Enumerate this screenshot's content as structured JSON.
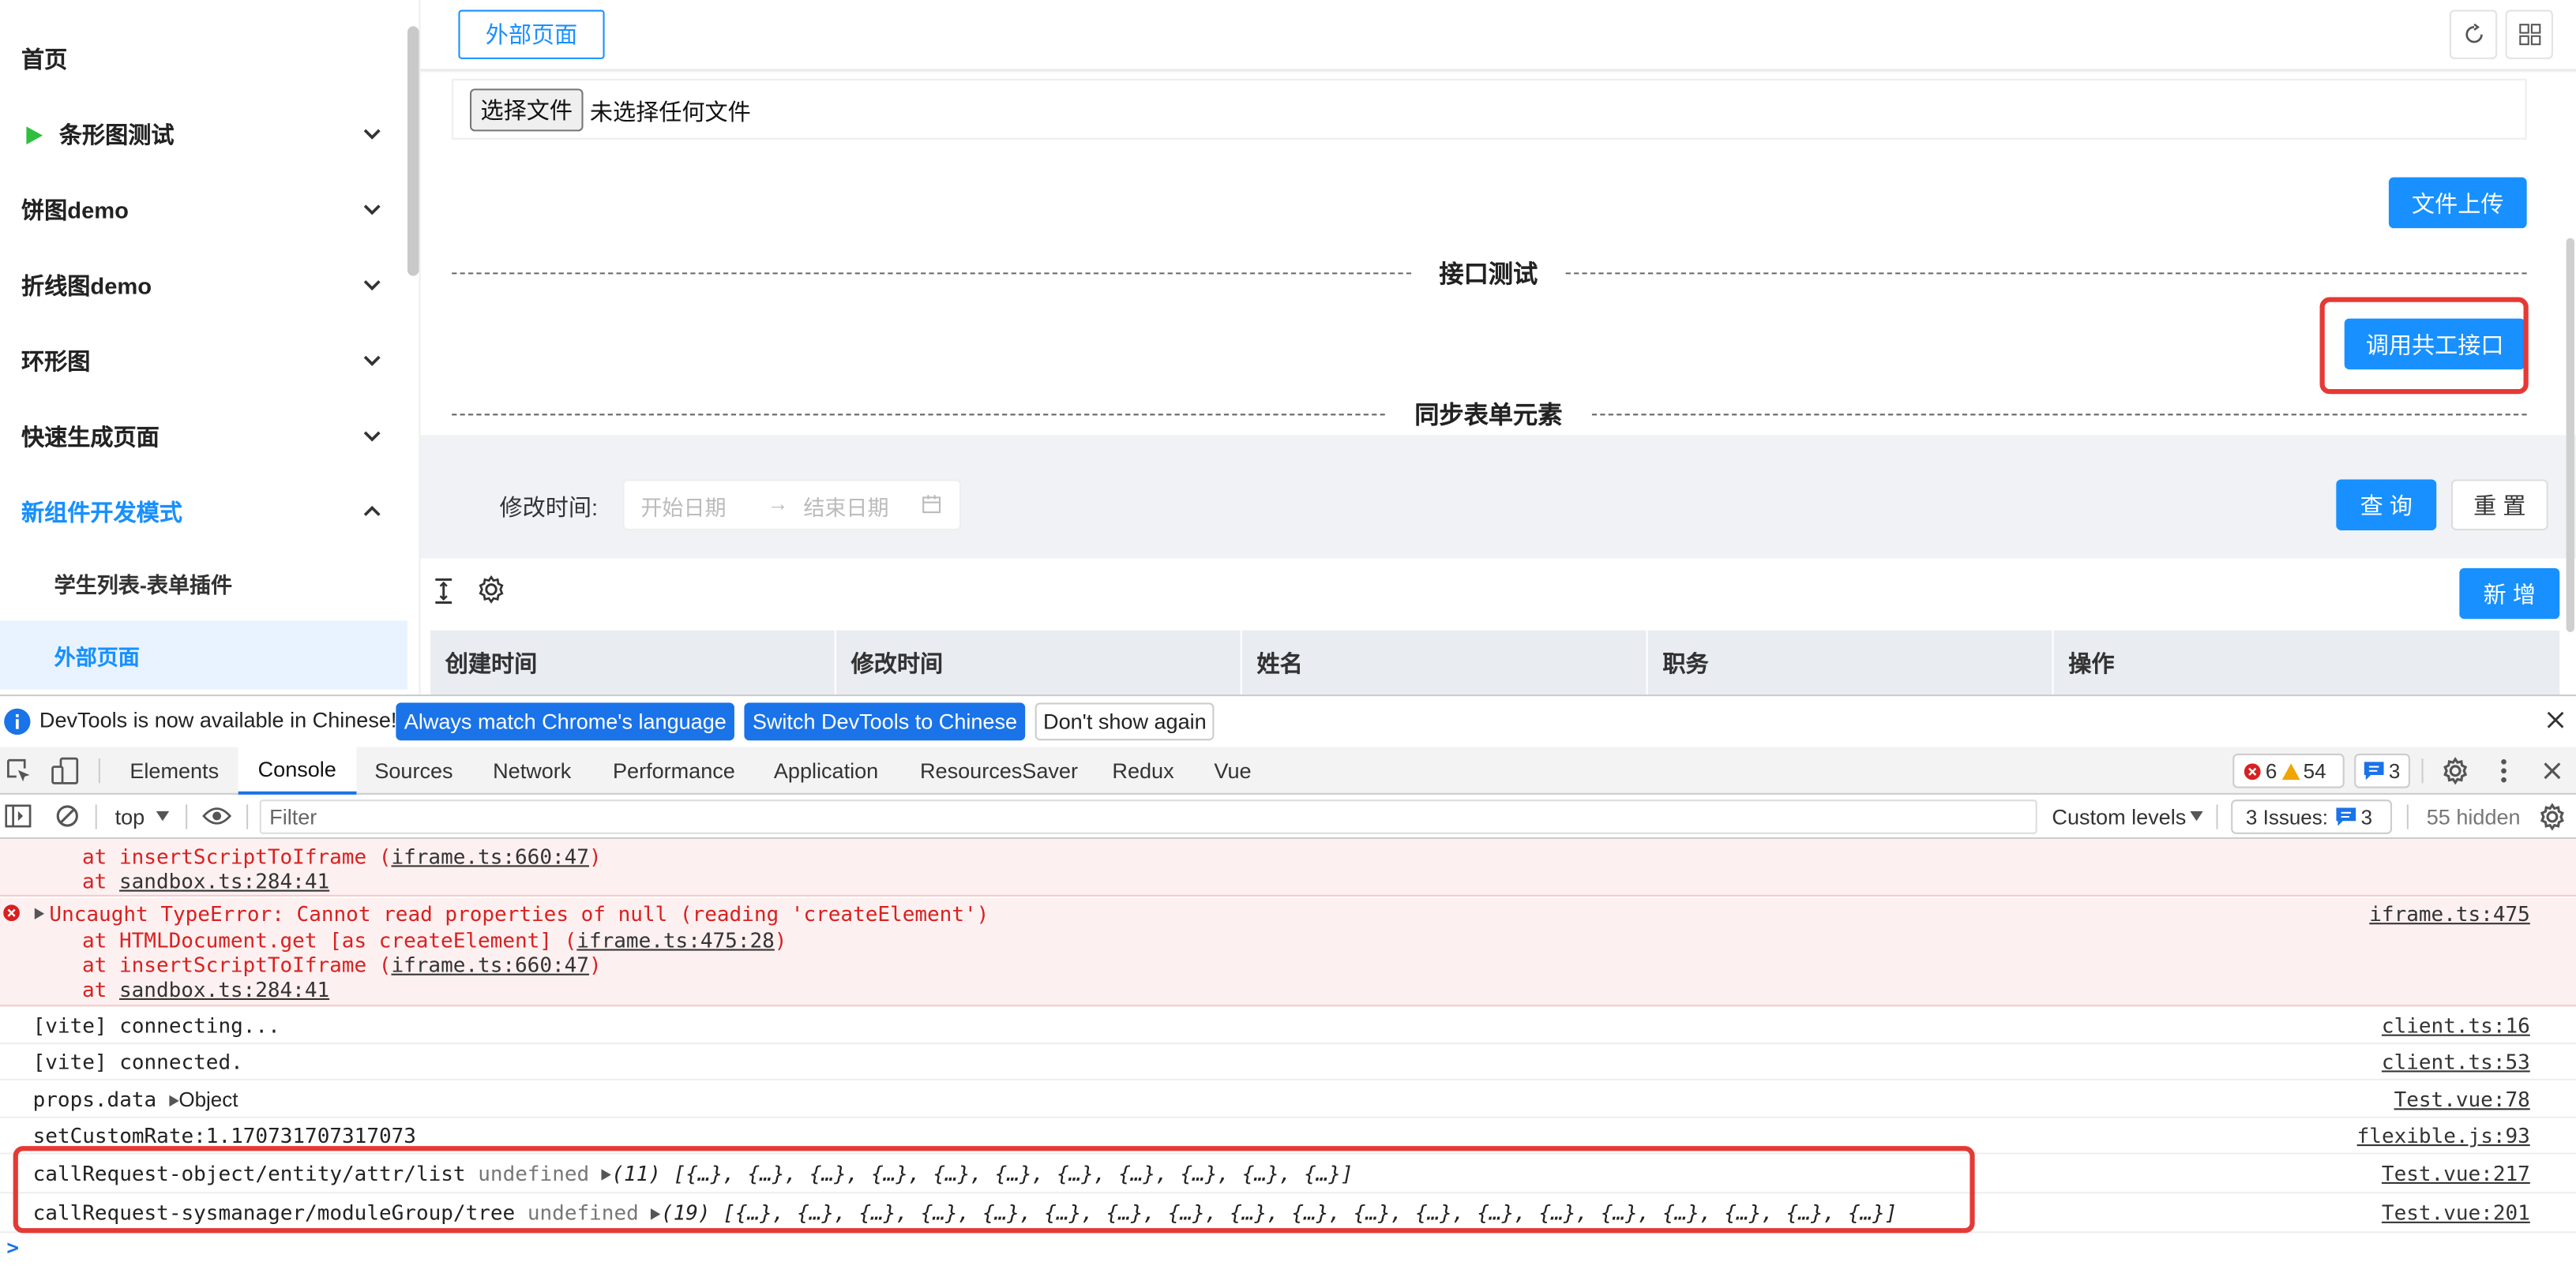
{
  "sidebar": {
    "items": [
      {
        "label": "首页"
      },
      {
        "label": "条形图测试"
      },
      {
        "label": "饼图demo"
      },
      {
        "label": "折线图demo"
      },
      {
        "label": "环形图"
      },
      {
        "label": "快速生成页面"
      },
      {
        "label": "新组件开发模式"
      }
    ],
    "subitems": [
      {
        "label": "学生列表-表单插件"
      },
      {
        "label": "外部页面"
      }
    ]
  },
  "main": {
    "active_tab": "外部页面",
    "file_button": "选择文件",
    "file_status": "未选择任何文件",
    "upload_button": "文件上传",
    "section_api": "接口测试",
    "call_button": "调用共工接口",
    "section_sync": "同步表单元素",
    "filter": {
      "label": "修改时间:",
      "start_placeholder": "开始日期",
      "end_placeholder": "结束日期",
      "separator": "→"
    },
    "query_button": "查 询",
    "reset_button": "重 置",
    "add_button": "新 增",
    "table_columns": [
      "创建时间",
      "修改时间",
      "姓名",
      "职务",
      "操作"
    ]
  },
  "devtools": {
    "banner": {
      "text": "DevTools is now available in Chinese!",
      "btn_match": "Always match Chrome's language",
      "btn_switch": "Switch DevTools to Chinese",
      "btn_dismiss": "Don't show again"
    },
    "tabs": [
      "Elements",
      "Console",
      "Sources",
      "Network",
      "Performance",
      "Application",
      "ResourcesSaver",
      "Redux",
      "Vue"
    ],
    "active_tab": "Console",
    "errors_count": "6",
    "warnings_count": "54",
    "messages_count": "3",
    "toolbar": {
      "context": "top",
      "filter_placeholder": "Filter",
      "levels": "Custom levels",
      "issues_label": "3 Issues:",
      "issues_count": "3",
      "hidden": "55 hidden"
    },
    "console": {
      "err1_l1_pre": "at insertScriptToIframe (",
      "err1_l1_link": "iframe.ts:660:47",
      "err1_l1_post": ")",
      "err1_l2_pre": "at ",
      "err1_l2_link": "sandbox.ts:284:41",
      "err2_msg": "Uncaught TypeError: Cannot read properties of null (reading 'createElement')",
      "err2_src": "iframe.ts:475",
      "err2_l1_pre": "at HTMLDocument.get [as createElement] (",
      "err2_l1_link": "iframe.ts:475:28",
      "err2_l1_post": ")",
      "err2_l2_pre": "at insertScriptToIframe (",
      "err2_l2_link": "iframe.ts:660:47",
      "err2_l2_post": ")",
      "err2_l3_pre": "at ",
      "err2_l3_link": "sandbox.ts:284:41",
      "log1": "[vite] connecting...",
      "log1_src": "client.ts:16",
      "log2": "[vite] connected.",
      "log2_src": "client.ts:53",
      "log3": "props.data",
      "log3_obj": "Object",
      "log3_src": "Test.vue:78",
      "log4": "setCustomRate:1.170731707317073",
      "log4_src": "flexible.js:93",
      "log5": "callRequest-object/entity/attr/list",
      "log5_undef": "undefined",
      "log5_arr": "(11) [{…}, {…}, {…}, {…}, {…}, {…}, {…}, {…}, {…}, {…}, {…}]",
      "log5_src": "Test.vue:217",
      "log6": "callRequest-sysmanager/moduleGroup/tree",
      "log6_undef": "undefined",
      "log6_arr": "(19) [{…}, {…}, {…}, {…}, {…}, {…}, {…}, {…}, {…}, {…}, {…}, {…}, {…}, {…}, {…}, {…}, {…}, {…}, {…}]",
      "log6_src": "Test.vue:201",
      "prompt": ">"
    }
  },
  "colors": {
    "primary": "#1890ff",
    "error": "#d92020",
    "highlight": "#e53935",
    "chrome_blue": "#1a73e8"
  }
}
